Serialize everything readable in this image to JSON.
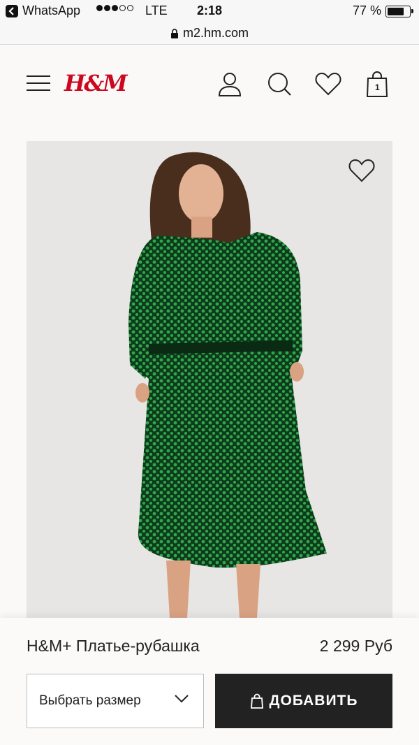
{
  "status_bar": {
    "back_app": "WhatsApp",
    "signal_dots": [
      true,
      true,
      true,
      false,
      false
    ],
    "carrier": "LTE",
    "time": "2:18",
    "battery_percent": "77 %",
    "battery_level": 0.77
  },
  "browser": {
    "url": "m2.hm.com"
  },
  "header": {
    "logo": "H&M",
    "brand_color": "#cc071e",
    "icons": [
      "menu-icon",
      "user-icon",
      "search-icon",
      "heart-icon",
      "bag-icon"
    ],
    "bag_count": "1"
  },
  "product": {
    "image_icon": "heart-outline-icon",
    "name": "H&M+ Платье-рубашка",
    "price": "2 299 Руб",
    "size_placeholder": "Выбрать размер",
    "add_label": "ДОБАВИТЬ"
  },
  "colors": {
    "button_bg": "#222222",
    "dress": "#1e8a3a"
  }
}
